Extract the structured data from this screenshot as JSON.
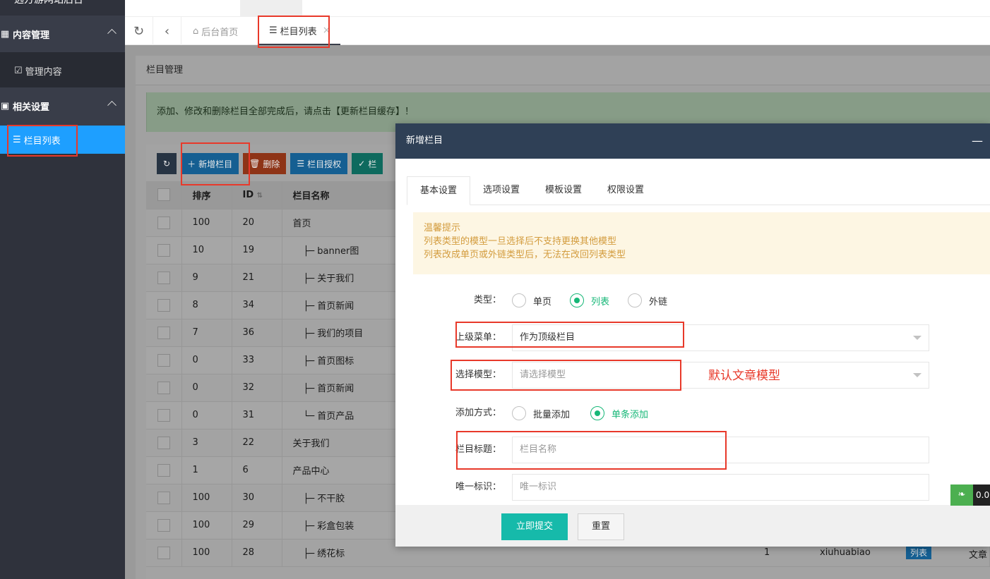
{
  "sidebar": {
    "logo": "远方游网站后台",
    "groups": [
      {
        "label": "内容管理",
        "icon": "grid-icon"
      },
      {
        "label": "相关设置",
        "icon": "settings-icon"
      }
    ],
    "sub_items": [
      {
        "label": "管理内容",
        "icon": "edit-icon"
      },
      {
        "label": "栏目列表",
        "icon": "list-icon"
      }
    ]
  },
  "tabs": [
    {
      "label": "后台首页",
      "icon": "home-icon"
    },
    {
      "label": "栏目列表",
      "icon": "list-icon"
    }
  ],
  "card": {
    "title": "栏目管理",
    "notice": "添加、修改和删除栏目全部完成后，请点击【更新栏目缓存】！"
  },
  "toolbar": {
    "add": "新增栏目",
    "delete": "删除",
    "auth": "栏目授权",
    "partial": "栏"
  },
  "table": {
    "headers": [
      "排序",
      "ID",
      "栏目名称"
    ],
    "rows": [
      {
        "sort": "100",
        "id": "20",
        "name": "首页"
      },
      {
        "sort": "10",
        "id": "19",
        "name": "├─ banner图"
      },
      {
        "sort": "9",
        "id": "21",
        "name": "├─ 关于我们"
      },
      {
        "sort": "8",
        "id": "34",
        "name": "├─ 首页新闻"
      },
      {
        "sort": "7",
        "id": "36",
        "name": "├─ 我们的项目"
      },
      {
        "sort": "0",
        "id": "33",
        "name": "├─ 首页图标"
      },
      {
        "sort": "0",
        "id": "32",
        "name": "├─ 首页新闻"
      },
      {
        "sort": "0",
        "id": "31",
        "name": "└─ 首页产品"
      },
      {
        "sort": "3",
        "id": "22",
        "name": "关于我们"
      },
      {
        "sort": "1",
        "id": "6",
        "name": "产品中心"
      },
      {
        "sort": "100",
        "id": "30",
        "name": "├─ 不干胶"
      },
      {
        "sort": "100",
        "id": "29",
        "name": "├─ 彩盒包装"
      },
      {
        "sort": "100",
        "id": "28",
        "name": "├─ 绣花标"
      }
    ],
    "visible_row_extra": {
      "col1": "1",
      "alias": "xiuhuabiao",
      "type_badge": "列表",
      "model": "文章"
    }
  },
  "modal": {
    "title": "新增栏目",
    "tabs": [
      "基本设置",
      "选项设置",
      "模板设置",
      "权限设置"
    ],
    "tips": [
      "温馨提示",
      "列表类型的模型一旦选择后不支持更换其他模型",
      "列表改成单页或外链类型后，无法在改回列表类型"
    ],
    "type_label": "类型",
    "type_options": [
      "单页",
      "列表",
      "外链"
    ],
    "parent_label": "上级菜单",
    "parent_value": "作为顶级栏目",
    "model_label": "选择模型",
    "model_placeholder": "请选择模型",
    "model_annotation": "默认文章模型",
    "add_mode_label": "添加方式",
    "add_mode_options": [
      "批量添加",
      "单条添加"
    ],
    "title_label": "栏目标题",
    "title_placeholder": "栏目名称",
    "uid_label": "唯一标识",
    "uid_placeholder": "唯一标识",
    "submit": "立即提交",
    "reset": "重置"
  },
  "widget": {
    "value": "0.0"
  }
}
